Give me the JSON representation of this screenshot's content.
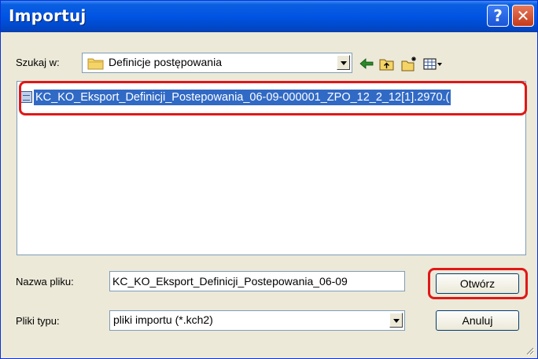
{
  "window": {
    "title": "Importuj"
  },
  "titlebar": {
    "help_glyph": "?",
    "close_glyph": "✕"
  },
  "lookin": {
    "label": "Szukaj w:",
    "folder": "Definicje postępowania"
  },
  "toolbar": {
    "icons": [
      "back-arrow-icon",
      "up-folder-icon",
      "new-folder-icon",
      "view-menu-icon"
    ]
  },
  "files": [
    {
      "name": "KC_KO_Eksport_Definicji_Postepowania_06-09-000001_ZPO_12_2_12[1].2970.("
    }
  ],
  "filename": {
    "label": "Nazwa pliku:",
    "value": "KC_KO_Eksport_Definicji_Postepowania_06-09"
  },
  "filetype": {
    "label": "Pliki typu:",
    "value": "pliki importu (*.kch2)"
  },
  "buttons": {
    "open": "Otwórz",
    "cancel": "Anuluj"
  },
  "colors": {
    "titlebar": "#0054e3",
    "selection": "#316ac5",
    "highlight": "#e01818",
    "dialog": "#ece9d8"
  }
}
